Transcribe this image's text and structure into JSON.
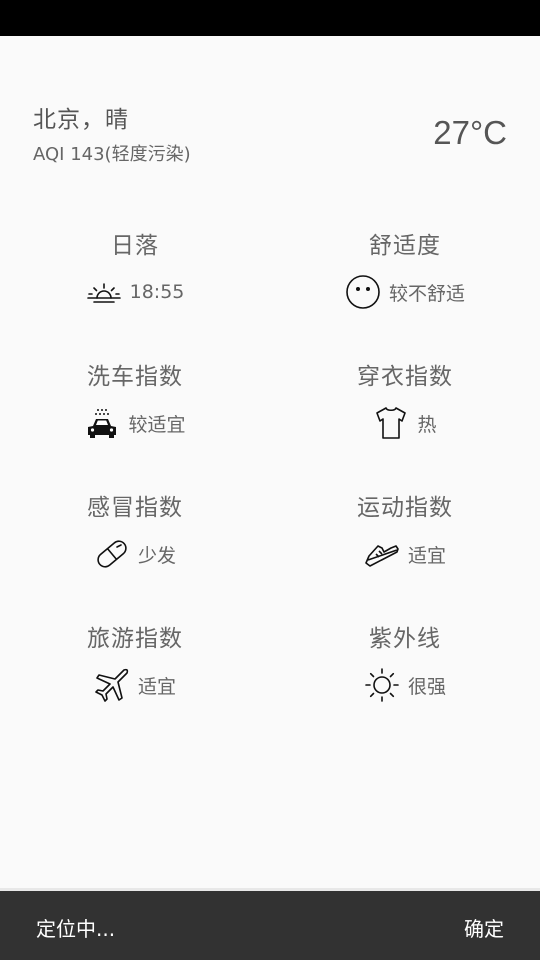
{
  "header": {
    "city": "北京，晴",
    "aqi": "AQI 143(轻度污染)",
    "temperature": "27°C"
  },
  "indices": [
    {
      "title": "日落",
      "value": "18:55",
      "icon": "sunset-icon"
    },
    {
      "title": "舒适度",
      "value": "较不舒适",
      "icon": "face-icon"
    },
    {
      "title": "洗车指数",
      "value": "较适宜",
      "icon": "car-wash-icon"
    },
    {
      "title": "穿衣指数",
      "value": "热",
      "icon": "tshirt-icon"
    },
    {
      "title": "感冒指数",
      "value": "少发",
      "icon": "pill-icon"
    },
    {
      "title": "运动指数",
      "value": "适宜",
      "icon": "sneaker-icon"
    },
    {
      "title": "旅游指数",
      "value": "适宜",
      "icon": "airplane-icon"
    },
    {
      "title": "紫外线",
      "value": "很强",
      "icon": "sun-icon"
    }
  ],
  "snackbar": {
    "message": "定位中...",
    "action": "确定"
  }
}
